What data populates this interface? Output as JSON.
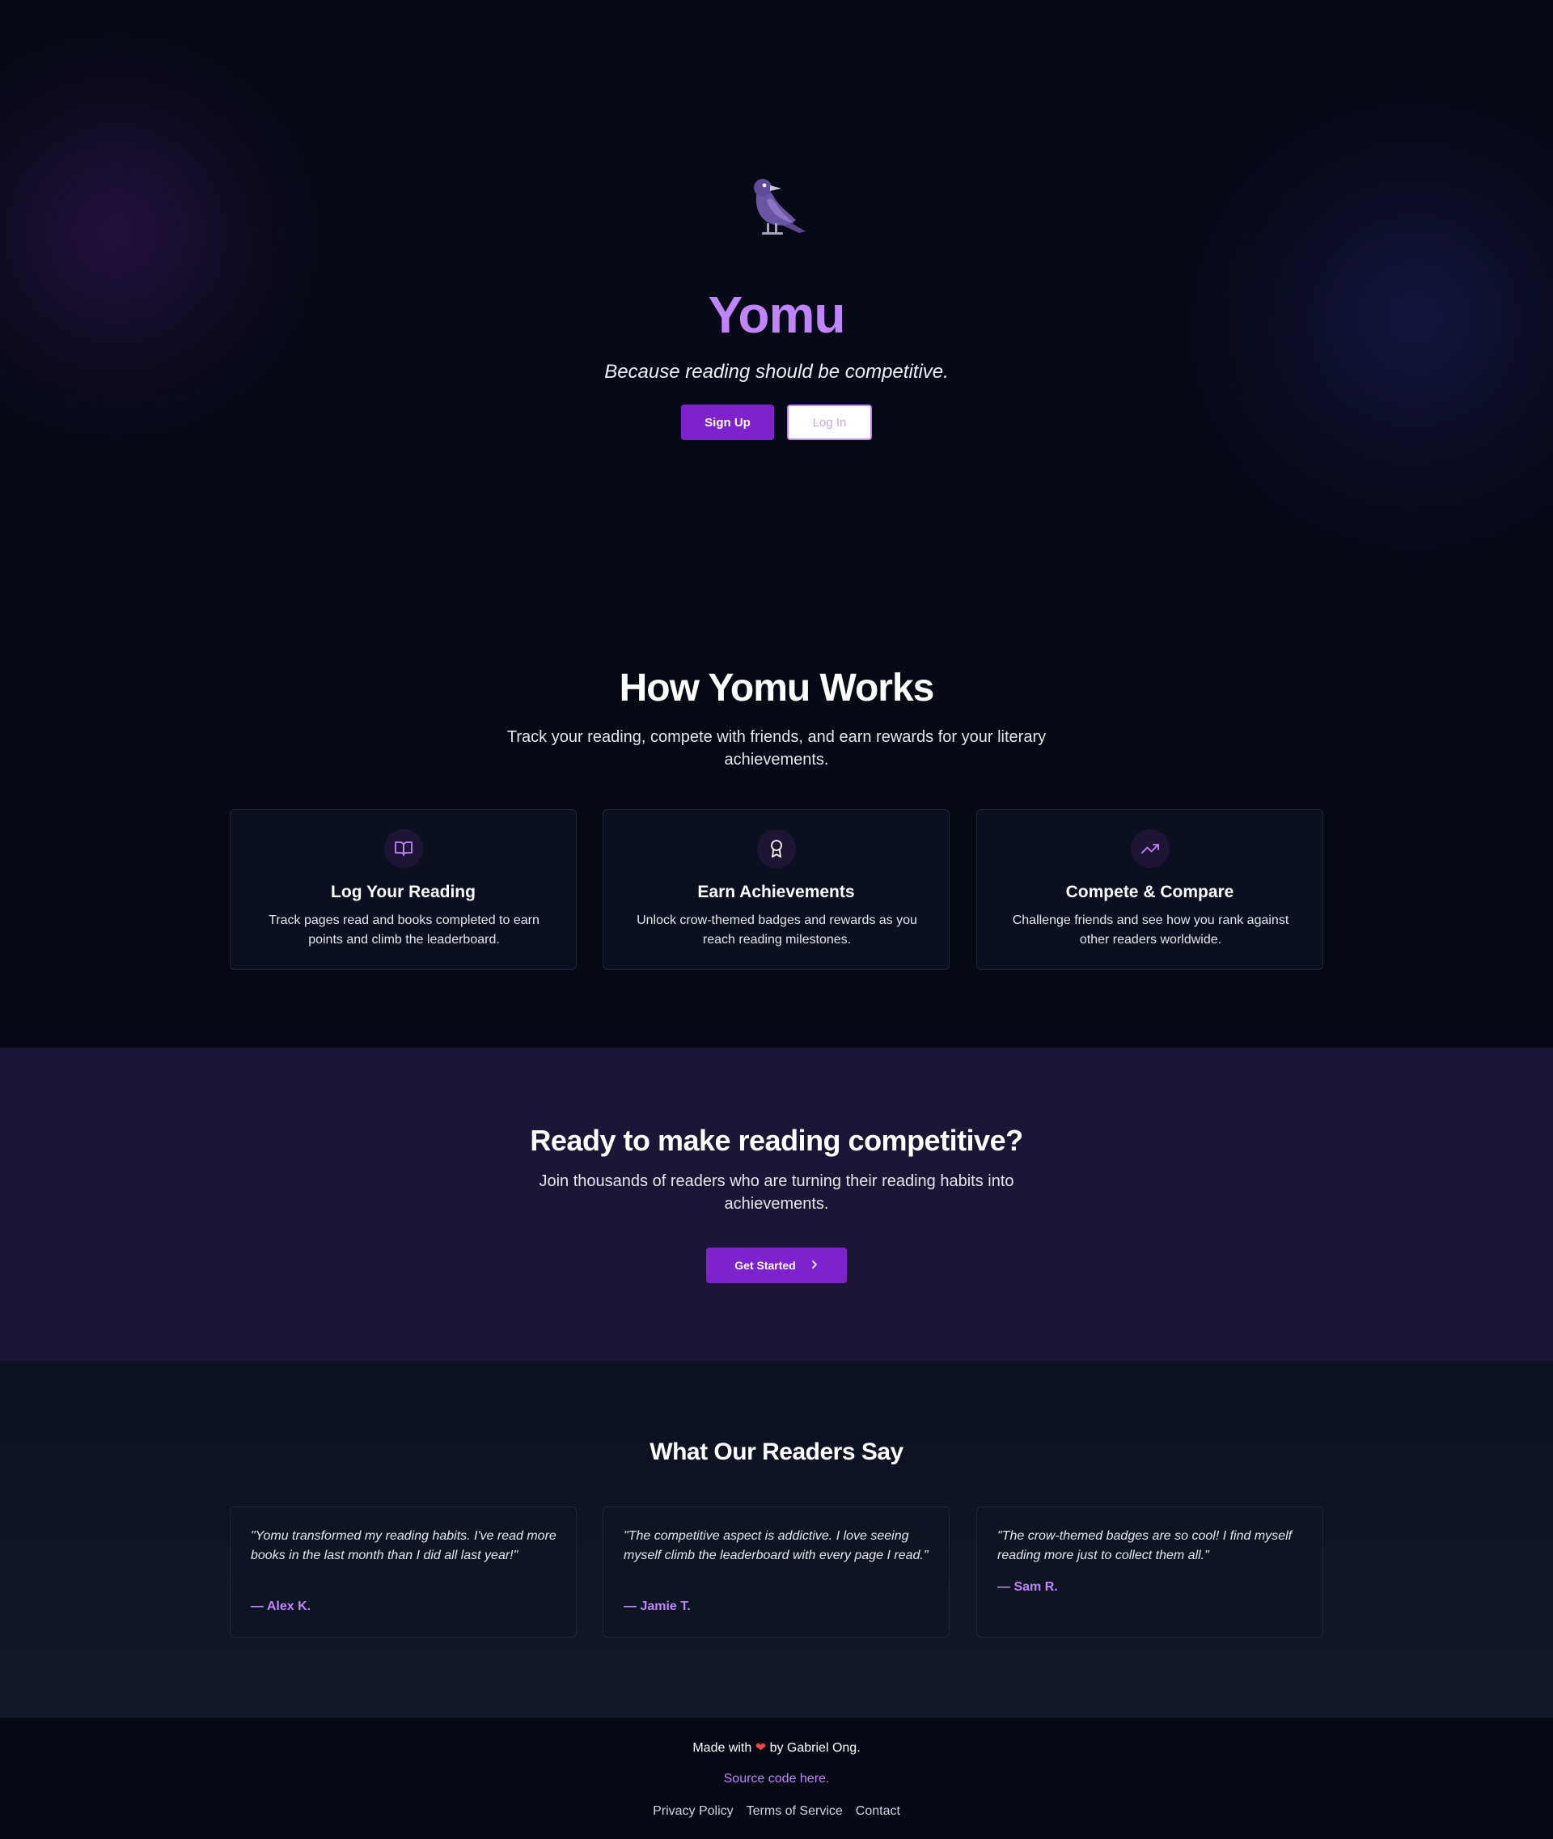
{
  "hero": {
    "brand": "Yomu",
    "tagline": "Because reading should be competitive.",
    "signup_label": "Sign Up",
    "login_label": "Log In"
  },
  "how": {
    "title": "How Yomu Works",
    "subtitle": "Track your reading, compete with friends, and earn rewards for your literary achievements.",
    "features": [
      {
        "icon": "book-open-icon",
        "title": "Log Your Reading",
        "desc": "Track pages read and books completed to earn points and climb the leaderboard."
      },
      {
        "icon": "award-icon",
        "title": "Earn Achievements",
        "desc": "Unlock crow-themed badges and rewards as you reach reading milestones."
      },
      {
        "icon": "trending-up-icon",
        "title": "Compete & Compare",
        "desc": "Challenge friends and see how you rank against other readers worldwide."
      }
    ]
  },
  "cta": {
    "title": "Ready to make reading competitive?",
    "subtitle": "Join thousands of readers who are turning their reading habits into achievements.",
    "button_label": "Get Started"
  },
  "reviews": {
    "title": "What Our Readers Say",
    "items": [
      {
        "quote": "\"Yomu transformed my reading habits. I've read more books in the last month than I did all last year!\"",
        "author": "— Alex K."
      },
      {
        "quote": "\"The competitive aspect is addictive. I love seeing myself climb the leaderboard with every page I read.\"",
        "author": "— Jamie T."
      },
      {
        "quote": "\"The crow-themed badges are so cool! I find myself reading more just to collect them all.\"",
        "author": "— Sam R."
      }
    ]
  },
  "footer": {
    "made_prefix": "Made with",
    "made_suffix": "by Gabriel Ong.",
    "source_label": "Source code here.",
    "links": [
      "Privacy Policy",
      "Terms of Service",
      "Contact"
    ]
  },
  "colors": {
    "accent": "#7e22ce",
    "brand": "#c084fc",
    "background": "#050914",
    "cta_background": "#1c1535"
  }
}
